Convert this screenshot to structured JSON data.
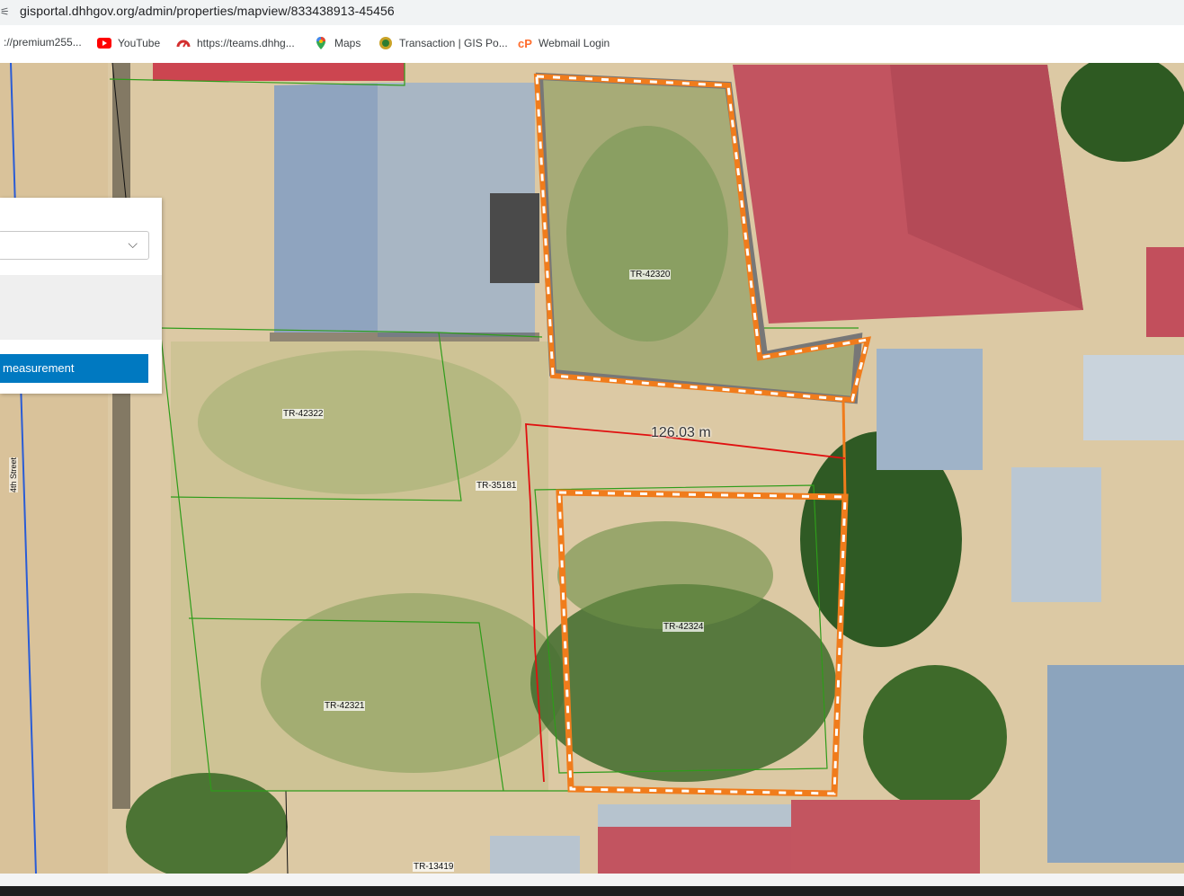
{
  "browser": {
    "url": "gisportal.dhhgov.org/admin/properties/mapview/833438913-45456",
    "bookmarks": [
      {
        "label": "://premium255...",
        "icon": "page-icon"
      },
      {
        "label": "YouTube",
        "icon": "youtube-icon"
      },
      {
        "label": "https://teams.dhhg...",
        "icon": "gauge-icon"
      },
      {
        "label": "Maps",
        "icon": "maps-pin-icon"
      },
      {
        "label": "Transaction | GIS Po...",
        "icon": "seal-icon"
      },
      {
        "label": "Webmail Login",
        "icon": "cpanel-icon"
      }
    ]
  },
  "panel": {
    "select_value": "",
    "button_label": " measurement"
  },
  "map": {
    "parcels": [
      "TR-42320",
      "TR-42322",
      "TR-35181",
      "TR-42324",
      "TR-42321",
      "TR-13419"
    ],
    "street": "4th Street",
    "measurement": "126.03 m"
  },
  "colors": {
    "parcel_line": "#2e9c1a",
    "selected_outline": "#f07c1c",
    "measure_line": "#e01010",
    "accent_button": "#0079c1"
  }
}
